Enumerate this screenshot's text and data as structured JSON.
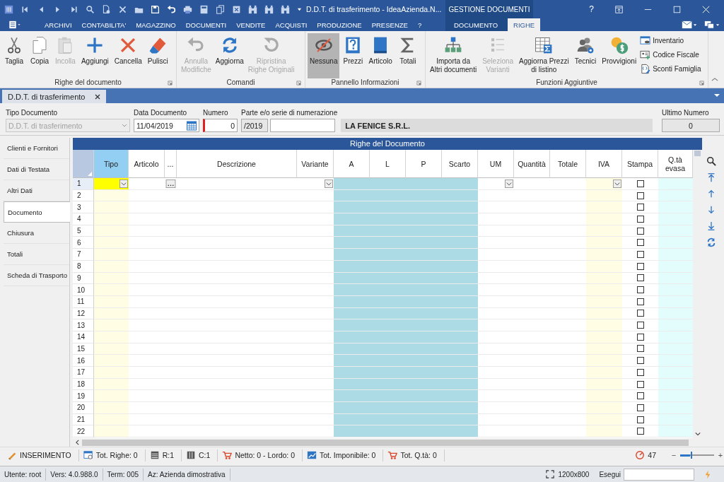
{
  "title_bar": {
    "title": "D.D.T. di trasferimento - IdeaAzienda.N...",
    "context_label": "GESTIONE DOCUMENTI",
    "help": "?"
  },
  "menu_tabs": [
    {
      "label": "ARCHIVI",
      "selected": false
    },
    {
      "label": "CONTABILITA'",
      "selected": false
    },
    {
      "label": "MAGAZZINO",
      "selected": false
    },
    {
      "label": "DOCUMENTI",
      "selected": false
    },
    {
      "label": "VENDITE",
      "selected": false
    },
    {
      "label": "ACQUISTI",
      "selected": false
    },
    {
      "label": "PRODUZIONE",
      "selected": false
    },
    {
      "label": "PRESENZE",
      "selected": false
    },
    {
      "label": "?",
      "selected": false
    }
  ],
  "context_tabs": [
    {
      "label": "DOCUMENTO",
      "selected": false
    },
    {
      "label": "RIGHE",
      "selected": true
    }
  ],
  "ribbon": {
    "groups": [
      {
        "label": "Righe del documento",
        "buttons": [
          {
            "label": "Taglia",
            "kind": "large",
            "disabled": false,
            "selected": false
          },
          {
            "label": "Copia",
            "kind": "large",
            "disabled": false,
            "selected": false
          },
          {
            "label": "Incolla",
            "kind": "large",
            "disabled": true,
            "selected": false
          },
          {
            "label": "Aggiungi",
            "kind": "large",
            "disabled": false,
            "selected": false
          },
          {
            "label": "Cancella",
            "kind": "large",
            "disabled": false,
            "selected": false
          },
          {
            "label": "Pulisci",
            "kind": "large",
            "disabled": false,
            "selected": false
          }
        ]
      },
      {
        "label": "Comandi",
        "buttons": [
          {
            "label": "Annulla\nModifiche",
            "kind": "large",
            "disabled": true,
            "selected": false
          },
          {
            "label": "Aggiorna",
            "kind": "large",
            "disabled": false,
            "selected": false
          },
          {
            "label": "Ripristina\nRighe Originali",
            "kind": "large",
            "disabled": true,
            "selected": false
          }
        ]
      },
      {
        "label": "Pannello Informazioni",
        "buttons": [
          {
            "label": "Nessuna",
            "kind": "large",
            "disabled": false,
            "selected": true
          },
          {
            "label": "Prezzi",
            "kind": "large",
            "disabled": false,
            "selected": false
          },
          {
            "label": "Articolo",
            "kind": "large",
            "disabled": false,
            "selected": false
          },
          {
            "label": "Totali",
            "kind": "large",
            "disabled": false,
            "selected": false
          }
        ]
      },
      {
        "label": "Funzioni Aggiuntive",
        "buttons": [
          {
            "label": "Importa da\nAltri documenti",
            "kind": "large",
            "disabled": false,
            "selected": false
          },
          {
            "label": "Seleziona\nVarianti",
            "kind": "large",
            "disabled": true,
            "selected": false
          },
          {
            "label": "Aggiorna Prezzi\ndi listino",
            "kind": "large",
            "disabled": false,
            "selected": false
          },
          {
            "label": "Tecnici",
            "kind": "large",
            "disabled": false,
            "selected": false
          },
          {
            "label": "Provvigioni",
            "kind": "large",
            "disabled": false,
            "selected": false
          },
          {
            "label": "Inventario",
            "kind": "small",
            "disabled": false,
            "selected": false
          },
          {
            "label": "Codice Fiscale",
            "kind": "small",
            "disabled": false,
            "selected": false
          },
          {
            "label": "Sconti Famiglia",
            "kind": "small",
            "disabled": false,
            "selected": false
          }
        ]
      }
    ]
  },
  "document_tabs": [
    {
      "label": "D.D.T. di trasferimento",
      "selected": true
    }
  ],
  "document_header": {
    "tipo_documento": {
      "label": "Tipo Documento",
      "value": "D.D.T. di trasferimento",
      "disabled": true
    },
    "data_documento": {
      "label": "Data Documento",
      "value": "11/04/2019"
    },
    "numero": {
      "label": "Numero",
      "value": "0"
    },
    "serie": {
      "label": "Parte e/o serie di numerazione",
      "value": "/2019"
    },
    "company": "LA FENICE S.R.L.",
    "ultimo_numero": {
      "label": "Ultimo Numero",
      "value": "0"
    }
  },
  "side_nav": [
    {
      "label": "Clienti e Fornitori",
      "selected": false
    },
    {
      "label": "Dati di Testata",
      "selected": false
    },
    {
      "label": "Altri Dati",
      "selected": false
    },
    {
      "label": "Documento",
      "selected": true
    },
    {
      "label": "Chiusura",
      "selected": false
    },
    {
      "label": "Totali",
      "selected": false
    },
    {
      "label": "Scheda di Trasporto",
      "selected": false
    }
  ],
  "grid": {
    "title": "Righe del Documento",
    "columns": [
      {
        "label": "Tipo",
        "selected": true,
        "color": "#fffde4"
      },
      {
        "label": "Articolo",
        "selected": false
      },
      {
        "label": "...",
        "selected": false
      },
      {
        "label": "Descrizione",
        "selected": false
      },
      {
        "label": "Variante",
        "selected": false
      },
      {
        "label": "A",
        "selected": false,
        "color": "#acdbe5"
      },
      {
        "label": "L",
        "selected": false,
        "color": "#acdbe5"
      },
      {
        "label": "P",
        "selected": false,
        "color": "#acdbe5"
      },
      {
        "label": "Scarto",
        "selected": false,
        "color": "#acdbe5"
      },
      {
        "label": "UM",
        "selected": false
      },
      {
        "label": "Quantità",
        "selected": false
      },
      {
        "label": "Totale",
        "selected": false
      },
      {
        "label": "IVA",
        "selected": false,
        "color": "#fffde4"
      },
      {
        "label": "Stampa",
        "selected": false
      },
      {
        "label": "Q.tà\nevasa",
        "selected": false,
        "color": "#e3fdfd"
      }
    ],
    "rows": [
      {
        "num": "1",
        "selected": true,
        "stampa": false
      },
      {
        "num": "2",
        "selected": false,
        "stampa": false
      },
      {
        "num": "3",
        "selected": false,
        "stampa": false
      },
      {
        "num": "4",
        "selected": false,
        "stampa": false
      },
      {
        "num": "5",
        "selected": false,
        "stampa": false
      },
      {
        "num": "6",
        "selected": false,
        "stampa": false
      },
      {
        "num": "7",
        "selected": false,
        "stampa": false
      },
      {
        "num": "8",
        "selected": false,
        "stampa": false
      },
      {
        "num": "9",
        "selected": false,
        "stampa": false
      },
      {
        "num": "10",
        "selected": false,
        "stampa": false
      },
      {
        "num": "11",
        "selected": false,
        "stampa": false
      },
      {
        "num": "12",
        "selected": false,
        "stampa": false
      },
      {
        "num": "13",
        "selected": false,
        "stampa": false
      },
      {
        "num": "14",
        "selected": false,
        "stampa": false
      },
      {
        "num": "15",
        "selected": false,
        "stampa": false
      },
      {
        "num": "16",
        "selected": false,
        "stampa": false
      },
      {
        "num": "17",
        "selected": false,
        "stampa": false
      },
      {
        "num": "18",
        "selected": false,
        "stampa": false
      },
      {
        "num": "19",
        "selected": false,
        "stampa": false
      },
      {
        "num": "20",
        "selected": false,
        "stampa": false
      },
      {
        "num": "21",
        "selected": false,
        "stampa": false
      },
      {
        "num": "22",
        "selected": false,
        "stampa": false
      }
    ]
  },
  "status_bar": {
    "items": [
      "INSERIMENTO",
      "Tot. Righe: 0",
      "R:1",
      "C:1",
      "Netto: 0 - Lordo: 0",
      "Tot. Imponibile: 0",
      "Tot. Q.tà: 0"
    ],
    "counter": "47",
    "zoom": {
      "minus": "−",
      "plus": "+",
      "level": 0.3
    }
  },
  "bottom_bar": {
    "items": [
      "Utente: root",
      "Vers: 4.0.988.0",
      "Term: 005",
      "Az: Azienda dimostrativa"
    ],
    "resolution": "1200x800",
    "run_label": "Esegui"
  }
}
